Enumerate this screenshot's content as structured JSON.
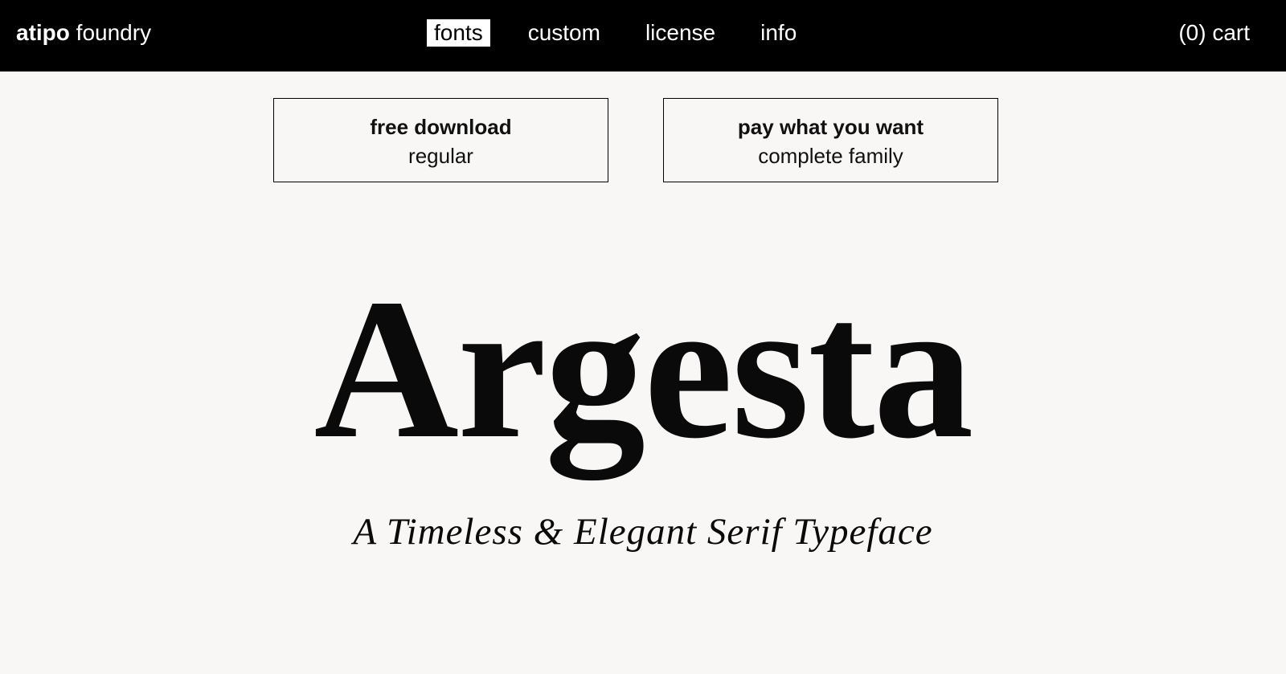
{
  "header": {
    "logo_bold": "atipo",
    "logo_regular": "foundry",
    "nav": [
      {
        "label": "fonts",
        "active": true
      },
      {
        "label": "custom",
        "active": false
      },
      {
        "label": "license",
        "active": false
      },
      {
        "label": "info",
        "active": false
      }
    ],
    "cart_label": "(0) cart"
  },
  "cta": {
    "free": {
      "title": "free download",
      "subtitle": "regular"
    },
    "pwyw": {
      "title": "pay what you want",
      "subtitle": "complete family"
    }
  },
  "hero": {
    "title": "Argesta",
    "subtitle": "A Timeless & Elegant Serif Typeface"
  },
  "colors": {
    "header_bg": "#000000",
    "page_bg": "#f8f7f5",
    "text": "#111111"
  }
}
